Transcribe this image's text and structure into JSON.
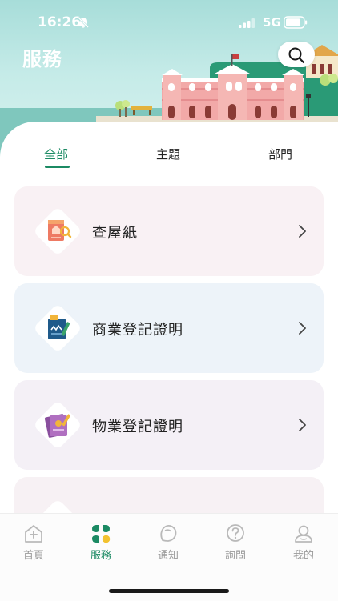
{
  "status_bar": {
    "time": "16:26",
    "network": "5G"
  },
  "header": {
    "title": "服務",
    "search_icon": "search-icon"
  },
  "tabs": [
    {
      "label": "全部",
      "active": true
    },
    {
      "label": "主題",
      "active": false
    },
    {
      "label": "部門",
      "active": false
    }
  ],
  "services": [
    {
      "label": "查屋紙",
      "icon": "house-document-icon",
      "bg": "#f9f1f4"
    },
    {
      "label": "商業登記證明",
      "icon": "business-registration-icon",
      "bg": "#edf3f9"
    },
    {
      "label": "物業登記證明",
      "icon": "property-registration-icon",
      "bg": "#f4f0f6"
    }
  ],
  "tabbar": [
    {
      "label": "首頁",
      "icon": "home-icon",
      "active": false
    },
    {
      "label": "服務",
      "icon": "services-icon",
      "active": true
    },
    {
      "label": "通知",
      "icon": "notification-icon",
      "active": false
    },
    {
      "label": "詢問",
      "icon": "help-icon",
      "active": false
    },
    {
      "label": "我的",
      "icon": "profile-icon",
      "active": false
    }
  ],
  "colors": {
    "accent": "#1b8a63",
    "header_bg": "#a7ddd9"
  }
}
